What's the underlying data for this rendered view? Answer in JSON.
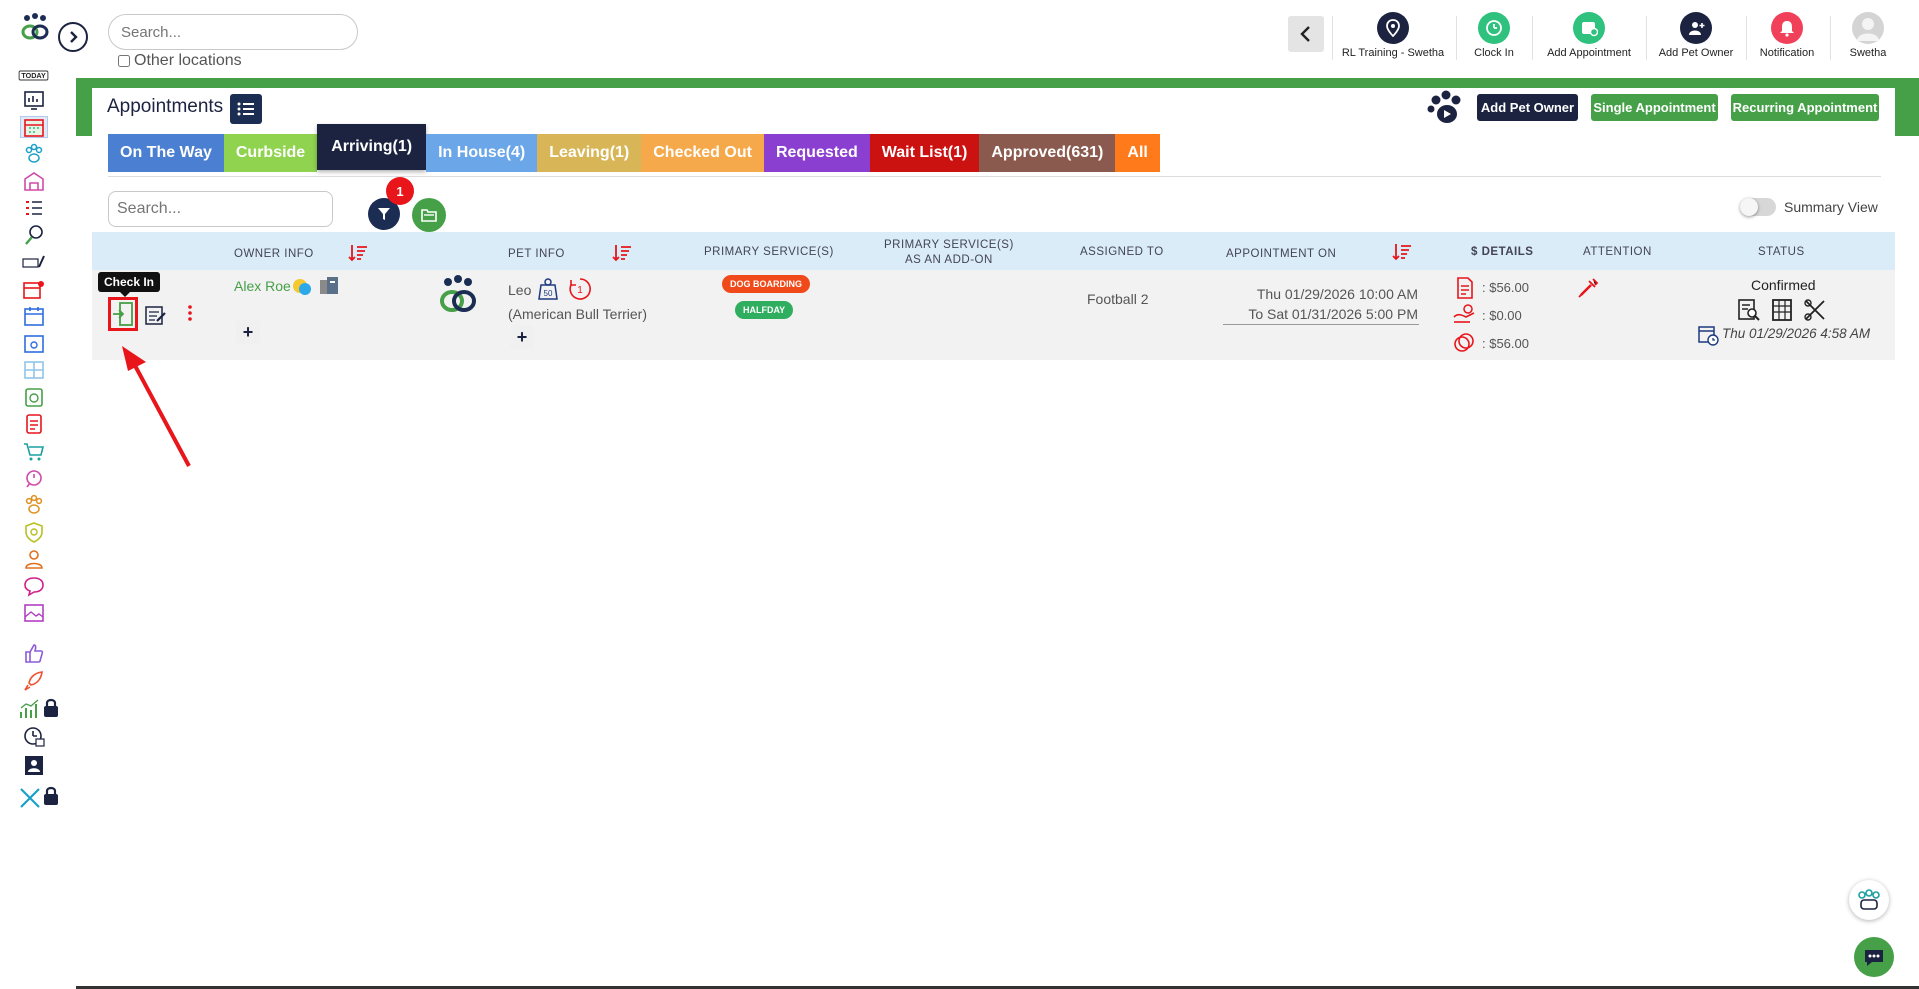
{
  "top": {
    "search_placeholder": "Search...",
    "other_locations": "Other locations",
    "actions": [
      {
        "label": "RL Training - Swetha",
        "icon": "location-pin-icon",
        "color": "#1c2340"
      },
      {
        "label": "Clock In",
        "icon": "clock-icon",
        "color": "#2ec27e"
      },
      {
        "label": "Add Appointment",
        "icon": "calendar-add-icon",
        "color": "#2ec27e"
      },
      {
        "label": "Add Pet Owner",
        "icon": "user-add-icon",
        "color": "#1c2340"
      },
      {
        "label": "Notification",
        "icon": "bell-icon",
        "color": "#f0405a"
      },
      {
        "label": "Swetha",
        "icon": "avatar",
        "color": "#bdbdbd"
      }
    ]
  },
  "sidebar": {
    "today_label": "TODAY",
    "items": [
      "today",
      "dashboard",
      "calendar",
      "pets",
      "kennels",
      "report-cards",
      "grooming",
      "today-daycare",
      "calendar-alert",
      "schedule",
      "calendar-user",
      "layout",
      "timer",
      "forms",
      "cart",
      "timer-alert",
      "paw-prints",
      "shield",
      "user",
      "chat",
      "image",
      "thumbs-up",
      "rocket",
      "analytics-locked",
      "clock-report",
      "badge-user",
      "tools-locked"
    ]
  },
  "header": {
    "title": "Appointments",
    "buttons": {
      "add_pet_owner": "Add Pet Owner",
      "single_appointment": "Single Appointment",
      "recurring_appointment": "Recurring Appointment"
    }
  },
  "tabs": [
    {
      "label": "On The Way",
      "color": "#4a7fd1",
      "active": false
    },
    {
      "label": "Curbside",
      "color": "#8fd34e",
      "active": false
    },
    {
      "label": "Arriving(1)",
      "color": "#1c2340",
      "active": true
    },
    {
      "label": "In House(4)",
      "color": "#6aa6e8",
      "active": false
    },
    {
      "label": "Leaving(1)",
      "color": "#d8b658",
      "active": false
    },
    {
      "label": "Checked Out",
      "color": "#f5a94a",
      "active": false
    },
    {
      "label": "Requested",
      "color": "#8b3fd1",
      "active": false
    },
    {
      "label": "Wait List(1)",
      "color": "#cc1111",
      "active": false
    },
    {
      "label": "Approved(631)",
      "color": "#8a5a4e",
      "active": false
    },
    {
      "label": "All",
      "color": "#ff7a1a",
      "active": false
    }
  ],
  "list": {
    "search_placeholder": "Search...",
    "filter_count": "1",
    "summary_view": "Summary View"
  },
  "table": {
    "headers": {
      "owner_info": "OWNER INFO",
      "pet_info": "PET INFO",
      "primary_services": "PRIMARY SERVICE(S)",
      "addon_line1": "PRIMARY SERVICE(S)",
      "addon_line2": "AS AN ADD-ON",
      "assigned_to": "ASSIGNED TO",
      "appointment_on": "APPOINTMENT ON",
      "details": "$ DETAILS",
      "attention": "ATTENTION",
      "status": "STATUS"
    },
    "row": {
      "tooltip": "Check In",
      "owner": "Alex Roe",
      "pet_name": "Leo",
      "pet_weight": "50",
      "pet_visits": "1",
      "pet_breed": "(American Bull Terrier)",
      "services": [
        {
          "label": "DOG BOARDING",
          "color": "#f04a1a"
        },
        {
          "label": "HALFDAY",
          "color": "#2eae5e"
        }
      ],
      "assigned_to": "Football 2",
      "appt_from": "Thu 01/29/2026 10:00 AM",
      "appt_to": "To Sat 01/31/2026 5:00 PM",
      "details": [
        ": $56.00",
        ": $0.00",
        ": $56.00"
      ],
      "status": "Confirmed",
      "status_date": "Thu 01/29/2026 4:58 AM"
    }
  },
  "colors": {
    "navy": "#1c2340",
    "green": "#45a047",
    "red": "#e8151b",
    "header_bg": "#d9ecf7"
  }
}
